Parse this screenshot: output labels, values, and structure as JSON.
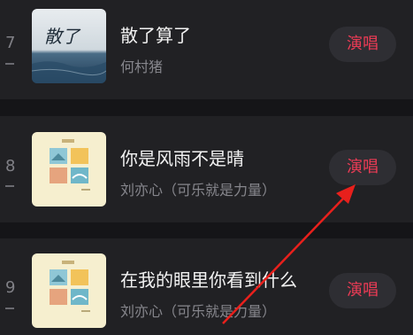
{
  "songs": [
    {
      "rank": "7",
      "title": "散了算了",
      "artist": "何村猪",
      "action": "演唱",
      "cover_text": "散了"
    },
    {
      "rank": "8",
      "title": "你是风雨不是晴",
      "artist": "刘亦心（可乐就是力量）",
      "action": "演唱",
      "cover_text": ""
    },
    {
      "rank": "9",
      "title": "在我的眼里你看到什么",
      "artist": "刘亦心（可乐就是力量）",
      "action": "演唱",
      "cover_text": ""
    }
  ],
  "colors": {
    "background": "#151518",
    "row": "#212124",
    "accent": "#ec3b55",
    "annotation_arrow": "#e8201c"
  },
  "icons": [
    "annotation-arrow"
  ]
}
